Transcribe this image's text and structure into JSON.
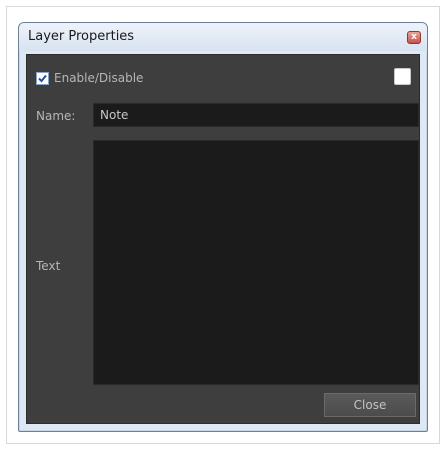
{
  "window": {
    "title": "Layer Properties",
    "close_glyph": "x"
  },
  "dialog": {
    "enable_label": "Enable/Disable",
    "enable_checked": true,
    "color_swatch": "#ffffff",
    "name_label": "Name:",
    "name_value": "Note",
    "text_label": "Text",
    "text_value": "",
    "close_button": "Close"
  },
  "colors": {
    "panel_bg": "#3e3e3e",
    "field_bg": "#1b1b1b",
    "label_text": "#b6b6b6"
  }
}
